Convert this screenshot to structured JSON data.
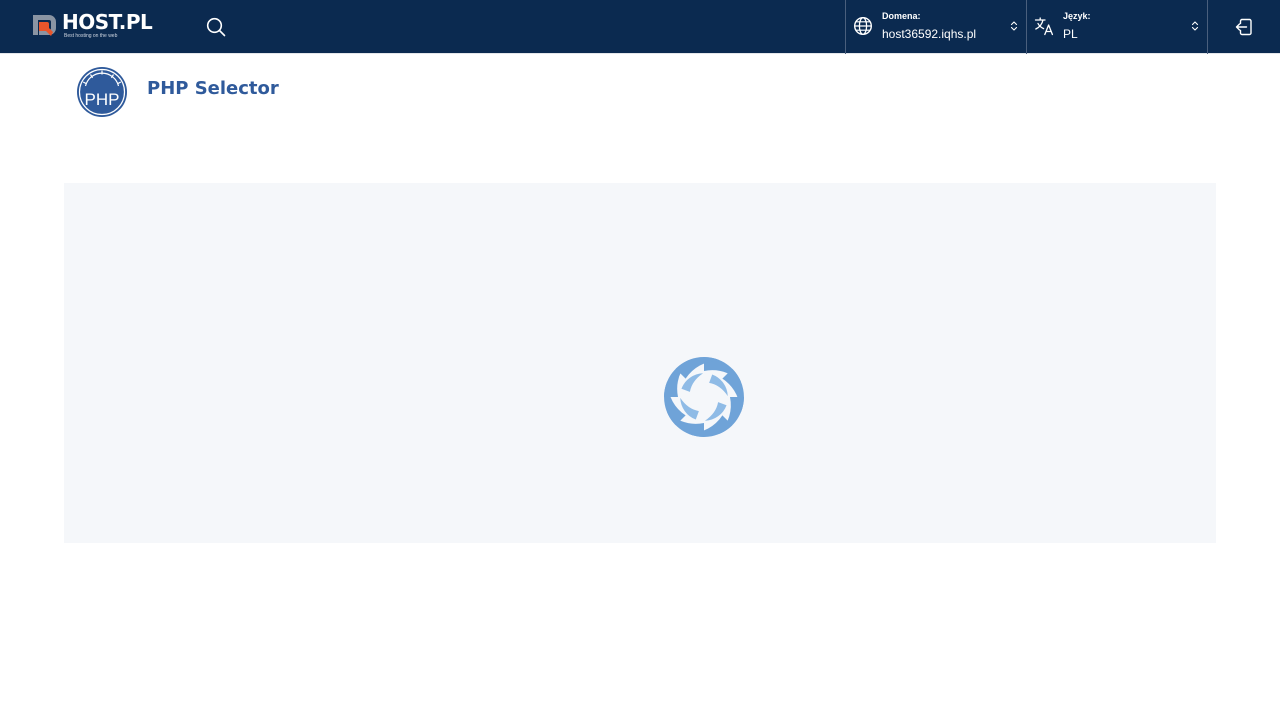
{
  "brand": {
    "name": "HOST.PL",
    "tagline": "Best hosting on the web",
    "accent_orange": "#e8552b",
    "mark_gray": "#8a94a3"
  },
  "topbar": {
    "background": "#0b2a50",
    "search_icon": "search-icon",
    "domain": {
      "label": "Domena:",
      "value": "host36592.iqhs.pl",
      "icon": "globe-icon"
    },
    "language": {
      "label": "Język:",
      "value": "PL",
      "icon": "translate-icon"
    },
    "logout_icon": "logout-icon"
  },
  "page": {
    "title": "PHP Selector",
    "logo_text": "PHP",
    "logo_color": "#2f5a9b",
    "title_color": "#2f5a9b"
  },
  "content": {
    "panel_background": "#f5f7fa",
    "spinner_color": "#6fa3d8",
    "state": "loading"
  }
}
